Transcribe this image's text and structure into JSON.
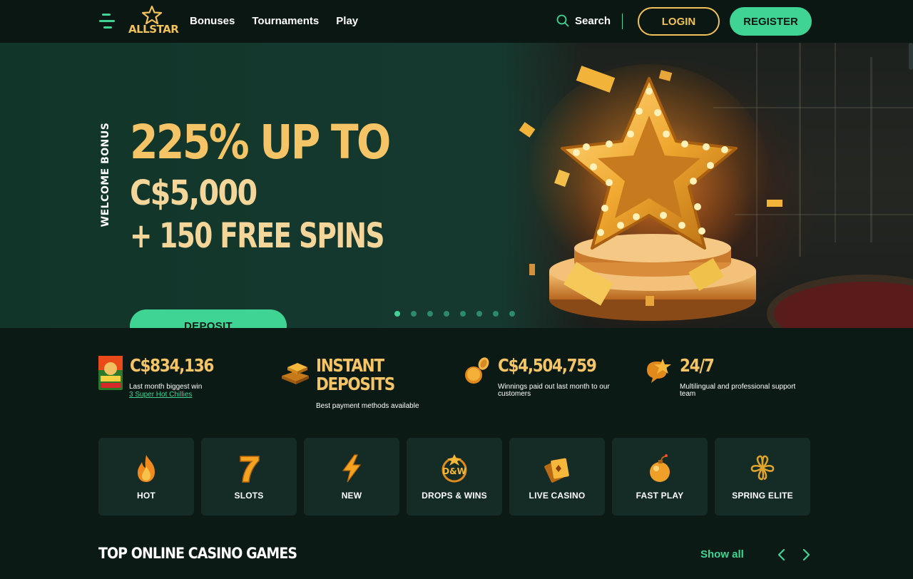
{
  "brand": {
    "logo_text": "ALLSTAR"
  },
  "nav": [
    {
      "label": "Bonuses"
    },
    {
      "label": "Tournaments"
    },
    {
      "label": "Play"
    }
  ],
  "header": {
    "search_label": "Search",
    "login_label": "LOGIN",
    "register_label": "REGISTER"
  },
  "hero": {
    "vertical_label": "WELCOME BONUS",
    "line1": "225% UP TO",
    "line2": "C$5,000",
    "line3": "+ 150 FREE SPINS",
    "cta_label": "DEPOSIT",
    "slides_count": 8,
    "active_slide": 1
  },
  "stats": [
    {
      "value": "C$834,136",
      "desc": "Last month biggest win",
      "link": "3 Super Hot Chillies"
    },
    {
      "value_line1": "INSTANT",
      "value_line2": "DEPOSITS",
      "desc": "Best payment methods available"
    },
    {
      "value": "C$4,504,759",
      "desc_line1": "Winnings paid out last month to our",
      "desc_line2": "customers"
    },
    {
      "value": "24/7",
      "desc_line1": "Multilingual and professional support",
      "desc_line2": "team"
    }
  ],
  "categories": [
    {
      "label": "HOT",
      "icon": "flame-icon"
    },
    {
      "label": "SLOTS",
      "icon": "seven-icon"
    },
    {
      "label": "NEW",
      "icon": "lightning-icon"
    },
    {
      "label": "DROPS & WINS",
      "icon": "drops-wins-icon"
    },
    {
      "label": "LIVE CASINO",
      "icon": "cards-icon"
    },
    {
      "label": "FAST PLAY",
      "icon": "bomb-icon"
    },
    {
      "label": "SPRING ELITE",
      "icon": "clover-icon"
    }
  ],
  "section": {
    "title": "TOP ONLINE CASINO GAMES",
    "show_all_label": "Show all"
  },
  "colors": {
    "accent_green": "#3fd494",
    "accent_gold": "#f5c466",
    "background": "#0c1a16",
    "card": "#142c25"
  }
}
